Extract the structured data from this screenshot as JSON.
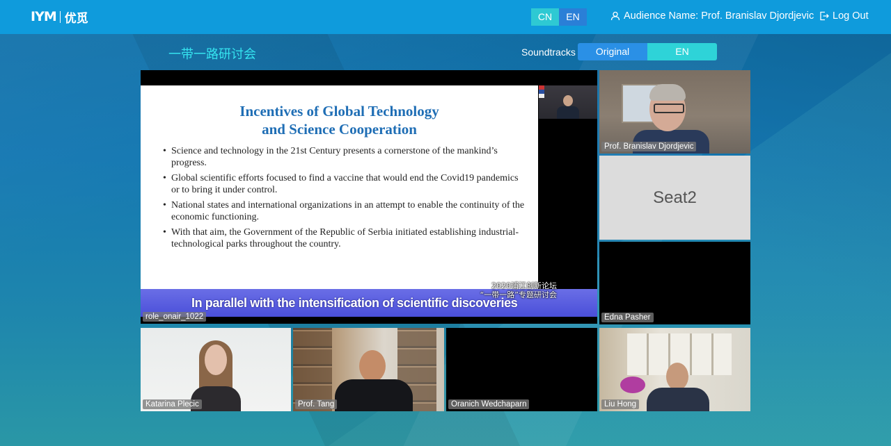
{
  "header": {
    "logo_mark": "IYM",
    "logo_text": "优觅",
    "lang_cn": "CN",
    "lang_en": "EN",
    "audience_label": "Audience Name: Prof. Branislav Djordjevic",
    "logout_label": "Log Out"
  },
  "room": {
    "title": "一带一路研讨会",
    "soundtracks_label": "Soundtracks",
    "soundtrack_options": [
      "Original",
      "EN"
    ]
  },
  "main_video": {
    "name": "role_onair_1022",
    "slide": {
      "title_line1": "Incentives of Global Technology",
      "title_line2": "and Science Cooperation",
      "bullets": [
        "Science and technology in the 21st Century presents a cornerstone of the mankind’s progress.",
        "Global scientific efforts focused to find a vaccine that would end the Covid19 pandemics or to bring it under control.",
        "National states and international organizations in an attempt to enable the continuity of the economic functioning.",
        "With that aim,  the Government of the Republic of Serbia initiated establishing industrial-technological parks throughout the country."
      ]
    },
    "caption": "In parallel with the intensification of scientific discoveries",
    "watermark_line1": "2020浦江创新论坛",
    "watermark_line2": "“一带一路”专题研讨会"
  },
  "participants": [
    {
      "name": "Prof. Branislav Djordjevic"
    },
    {
      "name": "Seat2"
    },
    {
      "name": "Edna Pasher"
    },
    {
      "name": "Katarina Plecic"
    },
    {
      "name": "Prof. Tang"
    },
    {
      "name": "Oranich Wedchaparn"
    },
    {
      "name": "Liu Hong"
    }
  ],
  "colors": {
    "topbar": "#0f9bdc",
    "accent_cyan": "#2ec9d3",
    "title_cyan": "#35e4f0",
    "caption_bar": "#4a4fd9"
  }
}
